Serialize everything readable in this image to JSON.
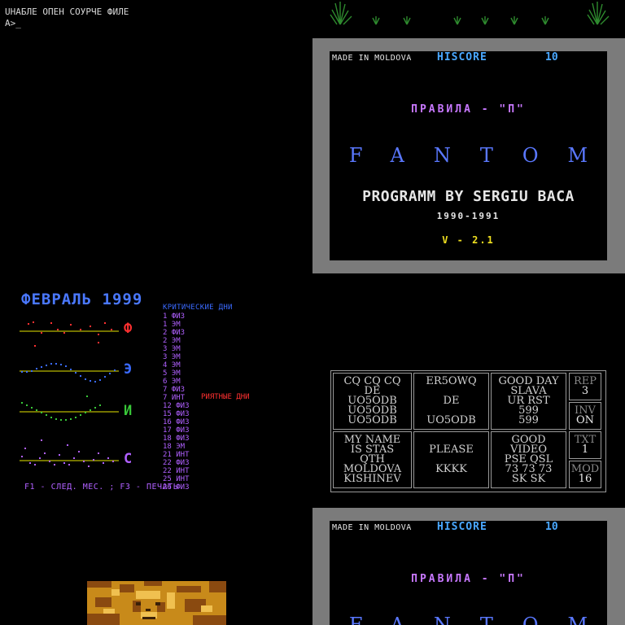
{
  "console": {
    "error_line": "UHAБЛE OПEH COУPЧE ФИЛE",
    "prompt": "A>_"
  },
  "fantom": {
    "made": "MADE IN MOLDOVA",
    "hiscore_label": "HISCORE",
    "hiscore_value": "10",
    "rules": "ПРАВИЛА - \"П\"",
    "title": "FANTOM",
    "byline": "PROGRAMM BY SERGIU BACA",
    "years": "1990-1991",
    "version": "V - 2.1"
  },
  "calendar": {
    "title": "ФЕВРАЛЬ 1999",
    "critical_heading": "КРИТИЧЕСКИЕ ДНИ",
    "pleasant_heading": "РИЯТНЫЕ ДНИ",
    "list_text": "1 ФИЗ\n1 ЭМ\n2 ФИЗ\n2 ЭМ\n3 ЭМ\n3 ЭМ\n4 ЭМ\n5 ЭМ\n6 ЭМ\n7 ФИЗ\n7 ИНТ\n12 ФИЗ\n15 ФИЗ\n16 ФИЗ\n17 ФИЗ\n18 ФИЗ\n18 ЭМ\n21 ИНТ\n22 ФИЗ\n22 ИНТ\n25 ИНТ\n26 ФИЗ",
    "labels": [
      "Ф",
      "Э",
      "И",
      "С"
    ],
    "label_colors": [
      "#ff3030",
      "#3a6aff",
      "#38c838",
      "#b060ff"
    ],
    "footer": "F1 - СЛЕД. МЕС. ; F3 - ПЕЧАТЬ"
  },
  "radio": {
    "cells": [
      [
        "CQ CQ CQ",
        "DE",
        "UO5ODB",
        "UO5ODB",
        "UO5ODB"
      ],
      [
        "ER5OWQ",
        "",
        "DE",
        "",
        "UO5ODB"
      ],
      [
        "GOOD DAY",
        "SLAVA",
        "UR RST",
        "599",
        "599"
      ],
      [
        "MY  NAME",
        "IS  STAS",
        "QTH",
        "MOLDOVA",
        "KISHINEV"
      ],
      [
        "",
        "PLEASE",
        "",
        "KKKK",
        ""
      ],
      [
        "GOOD",
        "VIDEO",
        "PSE  QSL",
        "73 73 73",
        "SK SK"
      ]
    ],
    "side": [
      {
        "label": "REP",
        "value": "3"
      },
      {
        "label": "INV",
        "value": "ON"
      },
      {
        "label": "TXT",
        "value": "1"
      },
      {
        "label": "MOD",
        "value": "16"
      }
    ]
  }
}
